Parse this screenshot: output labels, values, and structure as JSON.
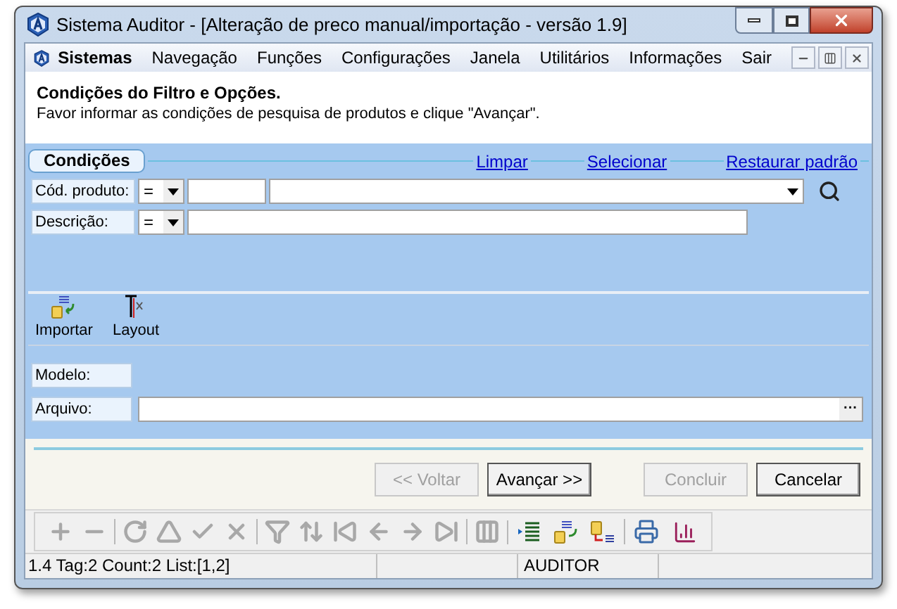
{
  "window": {
    "title": "Sistema Auditor - [Alteração de preco manual/importação - versão 1.9]"
  },
  "menu": {
    "items": [
      "Sistemas",
      "Navegação",
      "Funções",
      "Configurações",
      "Janela",
      "Utilitários",
      "Informações",
      "Sair"
    ]
  },
  "header": {
    "title": "Condições do Filtro e Opções.",
    "subtitle": "Favor informar as condições de pesquisa de produtos e clique \"Avançar\"."
  },
  "conditions": {
    "tab": "Condições",
    "links": [
      "Limpar",
      "Selecionar",
      "Restaurar padrão"
    ],
    "rows": [
      {
        "label": "Cód. produto:",
        "operator": "=",
        "kind": "lookup"
      },
      {
        "label": "Descrição:",
        "operator": "=",
        "kind": "text"
      }
    ]
  },
  "actions": [
    {
      "label": "Importar",
      "kind": "import"
    },
    {
      "label": "Layout",
      "kind": "layout"
    }
  ],
  "file": {
    "rows": [
      {
        "label": "Modelo:",
        "kind": "label"
      },
      {
        "label": "Arquivo:",
        "kind": "file",
        "button": "···"
      }
    ]
  },
  "buttons": [
    {
      "label": "<< Voltar",
      "disabled": true
    },
    {
      "label": "Avançar >>",
      "disabled": false
    },
    {
      "label": "Concluir",
      "disabled": true
    },
    {
      "label": "Cancelar",
      "disabled": false
    }
  ],
  "status_bar": {
    "info": "1.4 Tag:2 Count:2 List:[1,2]",
    "user": "AUDITOR"
  }
}
